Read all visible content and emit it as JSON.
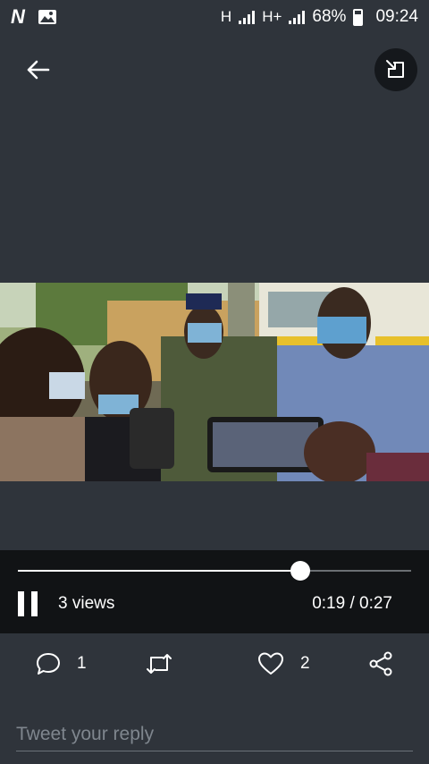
{
  "status_bar": {
    "network_1": "H",
    "network_2": "H+",
    "battery": "68%",
    "time": "09:24"
  },
  "icons": {
    "back": "arrow-left-icon",
    "pip": "picture-in-picture-icon",
    "reply": "comment-icon",
    "retweet": "retweet-icon",
    "like": "heart-icon",
    "share": "share-icon"
  },
  "player": {
    "progress": 0.718,
    "views": "3 views",
    "time": "0:19 / 0:27"
  },
  "actions": {
    "reply_count": "1",
    "like_count": "2"
  },
  "reply": {
    "placeholder": "Tweet your reply"
  },
  "colors": {
    "background": "#2f343b",
    "player_bar": "#111315",
    "accent": "#ffffff"
  }
}
